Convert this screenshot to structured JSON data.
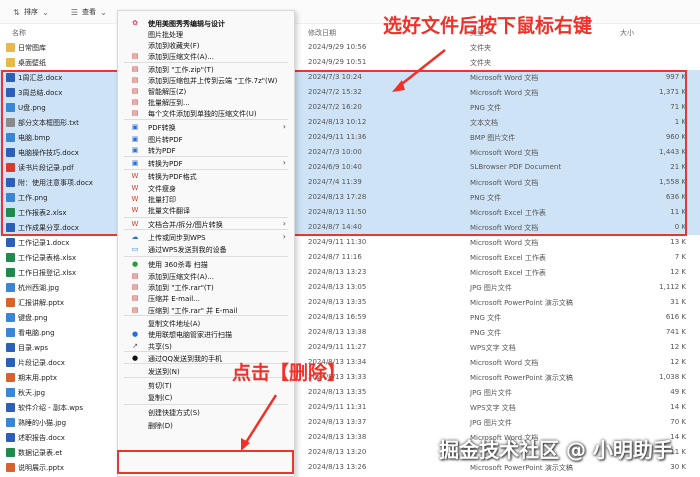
{
  "toolbar": {
    "sort_label": "排序",
    "view_label": "查看",
    "more_label": "···"
  },
  "columns": {
    "name": "名称",
    "date": "修改日期",
    "type": "类型",
    "size": "大小"
  },
  "files": [
    {
      "name": "日常图库",
      "date": "2024/9/29 10:56",
      "type": "文件夹",
      "size": "",
      "selected": false,
      "color": "#e8b94a"
    },
    {
      "name": "桌面壁纸",
      "date": "2024/9/29 10:51",
      "type": "文件夹",
      "size": "",
      "selected": false,
      "color": "#e8b94a"
    },
    {
      "name": "1周汇总.docx",
      "date": "2024/7/3 10:24",
      "type": "Microsoft Word 文档",
      "size": "997 K",
      "selected": true,
      "color": "#2b5fb8"
    },
    {
      "name": "3周总结.docx",
      "date": "2024/7/2 15:32",
      "type": "Microsoft Word 文档",
      "size": "1,371 K",
      "selected": true,
      "color": "#2b5fb8"
    },
    {
      "name": "U盘.png",
      "date": "2024/7/2 16:20",
      "type": "PNG 文件",
      "size": "71 K",
      "selected": true,
      "color": "#3a86d6"
    },
    {
      "name": "部分文本框图形.txt",
      "date": "2024/8/13 10:12",
      "type": "文本文档",
      "size": "1 K",
      "selected": true,
      "color": "#8a8a8a"
    },
    {
      "name": "电脑.bmp",
      "date": "2024/9/11 11:36",
      "type": "BMP 图片文件",
      "size": "960 K",
      "selected": true,
      "color": "#3a86d6"
    },
    {
      "name": "电脑操作技巧.docx",
      "date": "2024/7/3 10:00",
      "type": "Microsoft Word 文档",
      "size": "1,443 K",
      "selected": true,
      "color": "#2b5fb8"
    },
    {
      "name": "读书片段记录.pdf",
      "date": "2024/6/9 10:40",
      "type": "SLBrowser PDF Document",
      "size": "21 K",
      "selected": true,
      "color": "#d93a2b"
    },
    {
      "name": "附：使用注意事项.docx",
      "date": "2024/7/4 11:39",
      "type": "Microsoft Word 文档",
      "size": "1,558 K",
      "selected": true,
      "color": "#2b5fb8"
    },
    {
      "name": "工作.png",
      "date": "2024/8/13 17:28",
      "type": "PNG 文件",
      "size": "636 K",
      "selected": true,
      "color": "#3a86d6"
    },
    {
      "name": "工作报表2.xlsx",
      "date": "2024/8/13 11:50",
      "type": "Microsoft Excel 工作表",
      "size": "11 K",
      "selected": true,
      "color": "#1f8a4c"
    },
    {
      "name": "工作成果分享.docx",
      "date": "2024/8/7 14:40",
      "type": "Microsoft Word 文档",
      "size": "0 K",
      "selected": true,
      "color": "#2b5fb8"
    },
    {
      "name": "工作记录1.docx",
      "date": "2024/9/11 11:30",
      "type": "Microsoft Word 文档",
      "size": "13 K",
      "selected": false,
      "color": "#2b5fb8"
    },
    {
      "name": "工作记录表格.xlsx",
      "date": "2024/8/7 11:16",
      "type": "Microsoft Excel 工作表",
      "size": "7 K",
      "selected": false,
      "color": "#1f8a4c"
    },
    {
      "name": "工作日报登记.xlsx",
      "date": "2024/8/13 13:23",
      "type": "Microsoft Excel 工作表",
      "size": "12 K",
      "selected": false,
      "color": "#1f8a4c"
    },
    {
      "name": "杭州西湖.jpg",
      "date": "2024/8/13 13:05",
      "type": "JPG 图片文件",
      "size": "1,112 K",
      "selected": false,
      "color": "#3a86d6"
    },
    {
      "name": "汇报讲解.pptx",
      "date": "2024/8/13 13:35",
      "type": "Microsoft PowerPoint 演示文稿",
      "size": "31 K",
      "selected": false,
      "color": "#d9622b"
    },
    {
      "name": "键盘.png",
      "date": "2024/8/13 16:59",
      "type": "PNG 文件",
      "size": "616 K",
      "selected": false,
      "color": "#3a86d6"
    },
    {
      "name": "看电脑.png",
      "date": "2024/8/13 13:38",
      "type": "PNG 文件",
      "size": "741 K",
      "selected": false,
      "color": "#3a86d6"
    },
    {
      "name": "目录.wps",
      "date": "2024/9/11 11:27",
      "type": "WPS文字 文档",
      "size": "12 K",
      "selected": false,
      "color": "#2b5fb8"
    },
    {
      "name": "片段记录.docx",
      "date": "2024/8/13 13:34",
      "type": "Microsoft Word 文档",
      "size": "12 K",
      "selected": false,
      "color": "#2b5fb8"
    },
    {
      "name": "期末用.pptx",
      "date": "2024/8/13 13:33",
      "type": "Microsoft PowerPoint 演示文稿",
      "size": "1,038 K",
      "selected": false,
      "color": "#d9622b"
    },
    {
      "name": "秋天.jpg",
      "date": "2024/8/13 13:35",
      "type": "JPG 图片文件",
      "size": "49 K",
      "selected": false,
      "color": "#3a86d6"
    },
    {
      "name": "软件介绍 - 副本.wps",
      "date": "2024/9/11 11:31",
      "type": "WPS文字 文档",
      "size": "14 K",
      "selected": false,
      "color": "#2b5fb8"
    },
    {
      "name": "熟睡的小猫.jpg",
      "date": "2024/8/13 13:37",
      "type": "JPG 图片文件",
      "size": "70 K",
      "selected": false,
      "color": "#3a86d6"
    },
    {
      "name": "述职报告.docx",
      "date": "2024/8/13 13:38",
      "type": "Microsoft Word 文档",
      "size": "14 K",
      "selected": false,
      "color": "#2b5fb8"
    },
    {
      "name": "数据记录表.et",
      "date": "2024/8/13 13:20",
      "type": "",
      "size": "11 K",
      "selected": false,
      "color": "#1f8a4c"
    },
    {
      "name": "说明展示.pptx",
      "date": "2024/8/13 13:26",
      "type": "Microsoft PowerPoint 演示文稿",
      "size": "30 K",
      "selected": false,
      "color": "#d9622b"
    }
  ],
  "context_menu": {
    "items": [
      {
        "label": "使用美图秀秀编辑与设计",
        "icon": "meitu-icon",
        "glyph": "✿",
        "color": "#e83a6b",
        "bold": true
      },
      {
        "label": "图片批处理",
        "icon": "batch-icon",
        "glyph": "",
        "color": "#555"
      },
      {
        "label": "添加到收藏夹(F)",
        "icon": "none",
        "glyph": "",
        "color": "#555"
      },
      {
        "label": "添加到压缩文件(A)...",
        "icon": "archive-icon",
        "glyph": "▤",
        "color": "#c4352a"
      },
      {
        "label": "添加到 \"工作.zip\"(T)",
        "icon": "archive-icon",
        "glyph": "▤",
        "color": "#c4352a"
      },
      {
        "label": "添加到压缩包并上传到云端 \"工作.7z\"(W)",
        "icon": "archive-icon",
        "glyph": "▤",
        "color": "#c4352a"
      },
      {
        "label": "智能解压(Z)",
        "icon": "unzip-icon",
        "glyph": "▤",
        "color": "#c4352a"
      },
      {
        "label": "批量解压到...",
        "icon": "unzip-icon",
        "glyph": "▤",
        "color": "#c4352a"
      },
      {
        "label": "每个文件添加到单独的压缩文件(U)",
        "icon": "archive-icon",
        "glyph": "▤",
        "color": "#c4352a"
      },
      {
        "label": "PDF转换",
        "icon": "pdf-icon",
        "glyph": "▣",
        "color": "#2b6fd6",
        "arrow": true
      },
      {
        "label": "图片转PDF",
        "icon": "image-pdf-icon",
        "glyph": "▣",
        "color": "#2b6fd6"
      },
      {
        "label": "转为PDF",
        "icon": "pdf-icon",
        "glyph": "▣",
        "color": "#2b6fd6"
      },
      {
        "label": "转换为PDF",
        "icon": "pdf-icon",
        "glyph": "▣",
        "color": "#2b6fd6",
        "arrow": true
      },
      {
        "label": "转换为PDF格式",
        "icon": "wps-pdf-icon",
        "glyph": "W",
        "color": "#d93a2b"
      },
      {
        "label": "文件瘦身",
        "icon": "wps-icon",
        "glyph": "W",
        "color": "#d93a2b"
      },
      {
        "label": "批量打印",
        "icon": "print-icon",
        "glyph": "W",
        "color": "#d93a2b"
      },
      {
        "label": "批量文件翻译",
        "icon": "translate-icon",
        "glyph": "W",
        "color": "#d93a2b"
      },
      {
        "label": "文档合并/拆分/图片转换",
        "icon": "wps-icon",
        "glyph": "W",
        "color": "#d93a2b",
        "arrow": true
      },
      {
        "label": "上传或同步到WPS",
        "icon": "cloud-icon",
        "glyph": "☁",
        "color": "#2b6fd6",
        "arrow": true
      },
      {
        "label": "通过WPS发送到我的设备",
        "icon": "send-icon",
        "glyph": "▭",
        "color": "#2b6fd6"
      },
      {
        "label": "使用 360杀毒 扫描",
        "icon": "antivirus-icon",
        "glyph": "●",
        "color": "#2a9d3a"
      },
      {
        "label": "添加到压缩文件(A)...",
        "icon": "archive-icon",
        "glyph": "▤",
        "color": "#c4352a"
      },
      {
        "label": "添加到 \"工作.rar\"(T)",
        "icon": "archive-icon",
        "glyph": "▤",
        "color": "#c4352a"
      },
      {
        "label": "压缩并 E-mail...",
        "icon": "archive-icon",
        "glyph": "▤",
        "color": "#c4352a"
      },
      {
        "label": "压缩到 \"工作.rar\" 并 E-mail",
        "icon": "archive-icon",
        "glyph": "▤",
        "color": "#c4352a"
      },
      {
        "label": "复制文件地址(A)",
        "icon": "none",
        "glyph": "",
        "color": "#555"
      },
      {
        "label": "使用联想电脑管家进行扫描",
        "icon": "lenovo-icon",
        "glyph": "●",
        "color": "#2b6fd6"
      },
      {
        "label": "共享(S)",
        "icon": "share-icon",
        "glyph": "↗",
        "color": "#555"
      },
      {
        "label": "通过QQ发送到我的手机",
        "icon": "qq-icon",
        "glyph": "●",
        "color": "#111"
      },
      {
        "label": "发送到(N)",
        "icon": "none",
        "glyph": "",
        "color": "#555",
        "arrow": true
      },
      {
        "label": "剪切(T)",
        "icon": "none",
        "glyph": "",
        "color": "#555"
      },
      {
        "label": "复制(C)",
        "icon": "none",
        "glyph": "",
        "color": "#555"
      },
      {
        "label": "创建快捷方式(S)",
        "icon": "none",
        "glyph": "",
        "color": "#555"
      },
      {
        "label": "删除(D)",
        "icon": "none",
        "glyph": "",
        "color": "#555"
      }
    ]
  },
  "annotations": {
    "select_hint": "选好文件后按下鼠标右键",
    "delete_hint": "点击【删除】",
    "watermark": "掘金技术社区 @ 小明助手"
  },
  "colors": {
    "selection": "#cfe3f7",
    "annotation_red": "#e8372c"
  }
}
